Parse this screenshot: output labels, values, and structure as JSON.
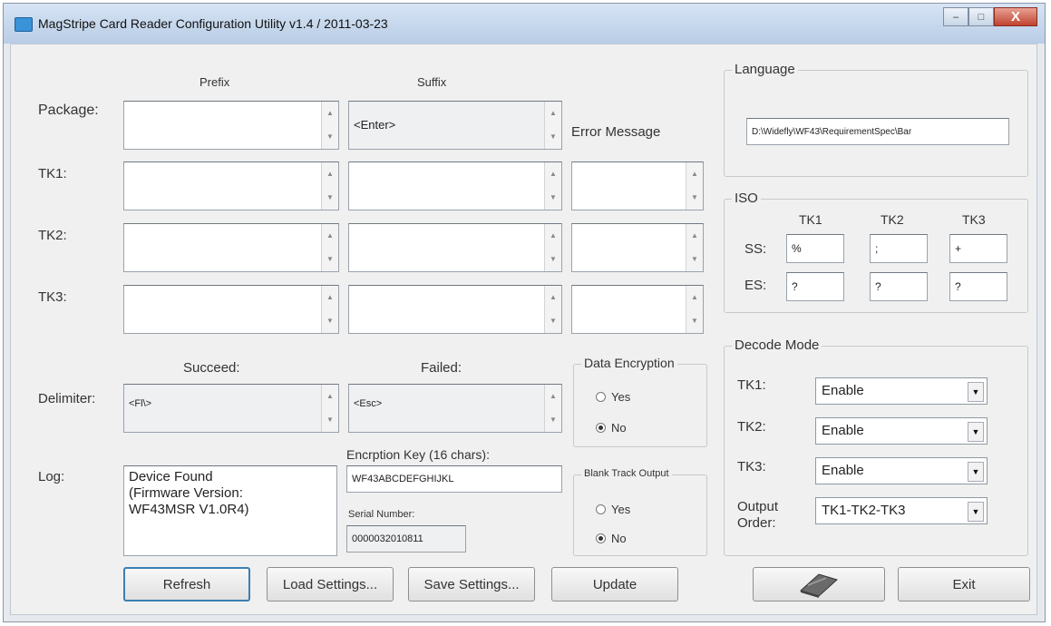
{
  "window": {
    "title": "MagStripe Card Reader Configuration Utility  v1.4 / 2011-03-23",
    "controls": {
      "minimize": "–",
      "maximize": "□",
      "close": "X"
    }
  },
  "headers": {
    "prefix": "Prefix",
    "suffix": "Suffix",
    "error_message": "Error Message"
  },
  "rows": {
    "package": {
      "label": "Package:",
      "prefix": "",
      "suffix": "<Enter>"
    },
    "tk1": {
      "label": "TK1:",
      "prefix": "",
      "suffix": "",
      "error": ""
    },
    "tk2": {
      "label": "TK2:",
      "prefix": "",
      "suffix": "",
      "error": ""
    },
    "tk3": {
      "label": "TK3:",
      "prefix": "",
      "suffix": "",
      "error": ""
    }
  },
  "delimiter": {
    "label": "Delimiter:",
    "succeed_header": "Succeed:",
    "failed_header": "Failed:",
    "succeed": "<Fl\\>",
    "failed": "<Esc>"
  },
  "log": {
    "label": "Log:",
    "text": "Device Found\n (Firmware Version:\nWF43MSR V1.0R4)"
  },
  "encryption_key": {
    "label": "Encrption Key (16 chars):",
    "value": "WF43ABCDEFGHIJKL"
  },
  "serial": {
    "label": "Serial Number:",
    "value": "0000032010811"
  },
  "data_encryption": {
    "title": "Data Encryption",
    "yes": "Yes",
    "no": "No",
    "selected": "No"
  },
  "blank_track": {
    "title": "Blank Track Output",
    "yes": "Yes",
    "no": "No",
    "selected": "No"
  },
  "language": {
    "title": "Language",
    "path": "D:\\Widefly\\WF43\\RequirementSpec\\Bar"
  },
  "iso": {
    "title": "ISO",
    "cols": [
      "TK1",
      "TK2",
      "TK3"
    ],
    "ss_label": "SS:",
    "es_label": "ES:",
    "ss": [
      "%",
      ";",
      "+"
    ],
    "es": [
      "?",
      "?",
      "?"
    ]
  },
  "decode_mode": {
    "title": "Decode Mode",
    "tk1_label": "TK1:",
    "tk1": "Enable",
    "tk2_label": "TK2:",
    "tk2": "Enable",
    "tk3_label": "TK3:",
    "tk3": "Enable",
    "output_label_1": "Output",
    "output_label_2": "Order:",
    "output": "TK1-TK2-TK3"
  },
  "buttons": {
    "refresh": "Refresh",
    "load": "Load Settings...",
    "save": "Save Settings...",
    "update": "Update",
    "card_icon": "card-swipe-icon",
    "exit": "Exit"
  }
}
